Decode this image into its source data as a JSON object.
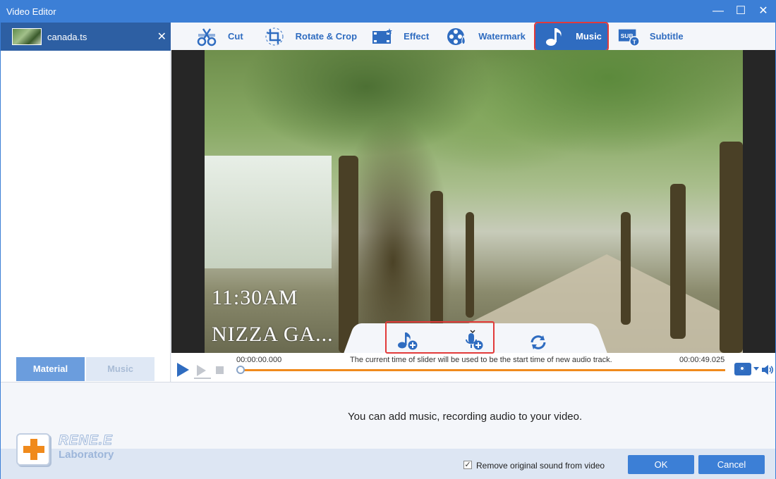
{
  "window": {
    "title": "Video Editor",
    "controls": [
      "minimize",
      "maximize",
      "close"
    ]
  },
  "sidebar": {
    "file": {
      "name": "canada.ts",
      "close_glyph": "✕"
    },
    "tabs": [
      {
        "label": "Material",
        "active": true
      },
      {
        "label": "Music",
        "active": false
      }
    ]
  },
  "toolbar": {
    "items": [
      {
        "label": "Cut",
        "icon": "cut-icon",
        "active": false
      },
      {
        "label": "Rotate & Crop",
        "icon": "rotate-crop-icon",
        "active": false
      },
      {
        "label": "Effect",
        "icon": "effect-icon",
        "active": false
      },
      {
        "label": "Watermark",
        "icon": "watermark-icon",
        "active": false
      },
      {
        "label": "Music",
        "icon": "music-note-icon",
        "active": true
      },
      {
        "label": "Subtitle",
        "icon": "subtitle-icon",
        "active": false
      }
    ]
  },
  "video": {
    "overlay_time": "11:30AM",
    "overlay_location": "NIZZA GA..."
  },
  "audio_panel": {
    "add_music": "add-music-icon",
    "add_recording": "add-recording-icon",
    "refresh": "refresh-icon"
  },
  "player": {
    "time_start": "00:00:00.000",
    "time_end": "00:00:49.025",
    "hint": "The current time of slider will be used to be the start time of new audio track.",
    "slider_position_fraction": 0
  },
  "message": "You can add music, recording audio to your video.",
  "footer": {
    "logo_name": "RENE.E",
    "logo_sub": "Laboratory",
    "remove_sound_label": "Remove original sound from video",
    "remove_sound_checked": true,
    "ok_label": "OK",
    "cancel_label": "Cancel"
  },
  "colors": {
    "accent": "#3c7fd6",
    "highlight": "#e23a3a",
    "slider": "#f08a1c"
  }
}
